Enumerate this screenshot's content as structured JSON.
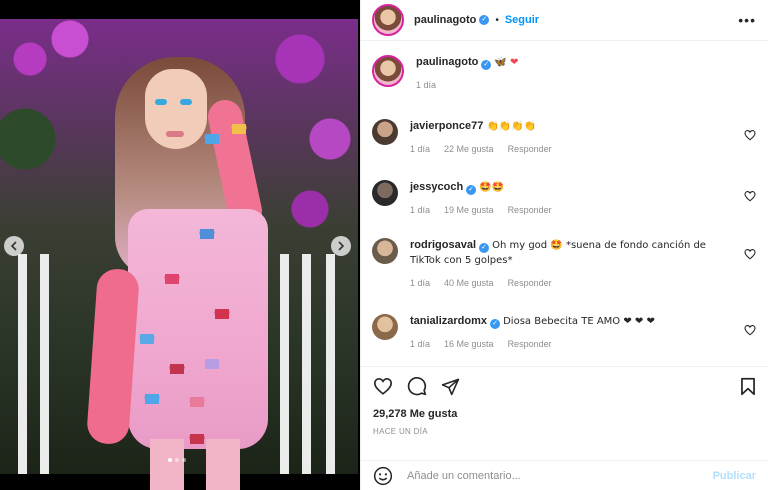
{
  "post": {
    "username": "paulinagoto",
    "follow_label": "Seguir",
    "bullet": "•",
    "more_label": "•••",
    "caption": "🦋 ❤",
    "caption_time": "1 día",
    "likes": "29,278 Me gusta",
    "posted_ago": "HACE UN DÍA",
    "carousel": {
      "total": 3,
      "active": 1
    }
  },
  "comments": [
    {
      "username": "javierponce77",
      "verified": false,
      "text": "👏👏👏👏",
      "time": "1 día",
      "likes": "22 Me gusta",
      "reply": "Responder"
    },
    {
      "username": "jessycoch",
      "verified": true,
      "text": "🤩🤩",
      "time": "1 día",
      "likes": "19 Me gusta",
      "reply": "Responder"
    },
    {
      "username": "rodrigosaval",
      "verified": true,
      "text": "Oh my god 🤩 *suena de fondo canción de TikTok con 5 golpes*",
      "time": "1 día",
      "likes": "40 Me gusta",
      "reply": "Responder"
    },
    {
      "username": "tanializardomx",
      "verified": true,
      "text": "Diosa Bebecita TE AMO ❤ ❤ ❤",
      "time": "1 día",
      "likes": "16 Me gusta",
      "reply": "Responder"
    }
  ],
  "add_comment": {
    "placeholder": "Añade un comentario...",
    "publish_label": "Publicar"
  },
  "colors": {
    "accent": "#0095f6",
    "publish_disabled": "#b2dffc",
    "meta_gray": "#8e8e8e",
    "heart_red": "#ed4956"
  },
  "icons": {
    "nav_prev": "chevron-left-icon",
    "nav_next": "chevron-right-icon",
    "like": "heart-icon",
    "comment": "comment-icon",
    "share": "paper-plane-icon",
    "save": "bookmark-icon",
    "emoji": "smiley-icon",
    "verified": "verified-badge-icon"
  }
}
